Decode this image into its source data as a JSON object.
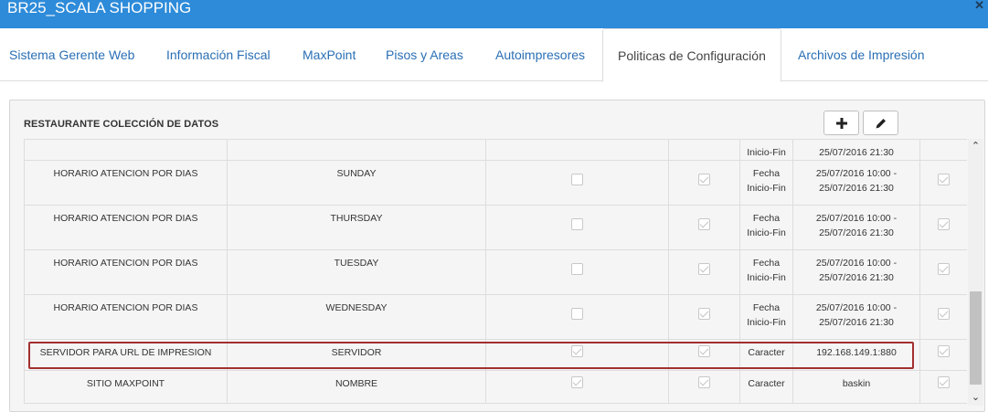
{
  "window": {
    "title": "BR25_SCALA SHOPPING",
    "close_glyph": "✕"
  },
  "tabs": [
    {
      "label": "Sistema Gerente Web"
    },
    {
      "label": "Información Fiscal"
    },
    {
      "label": "MaxPoint"
    },
    {
      "label": "Pisos y Areas"
    },
    {
      "label": "Autoimpresores"
    },
    {
      "label": "Politicas de Configuración"
    },
    {
      "label": "Archivos de Impresión"
    }
  ],
  "active_tab": "Politicas de Configuración",
  "panel": {
    "title": "RESTAURANTE COLECCIÓN DE DATOS",
    "add_button_icon": "plus-icon",
    "edit_button_icon": "pencil-icon"
  },
  "rows": [
    {
      "policy": "",
      "parameter": "",
      "checked1": null,
      "checked2": null,
      "type": "Inicio-Fin",
      "value": "25/07/2016 21:30",
      "active": null
    },
    {
      "policy": "HORARIO ATENCION POR DIAS",
      "parameter": "SUNDAY",
      "checked1": false,
      "checked2": true,
      "type_1": "Fecha",
      "type_2": "Inicio-Fin",
      "value_1": "25/07/2016 10:00 -",
      "value_2": "25/07/2016 21:30",
      "active": true
    },
    {
      "policy": "HORARIO ATENCION POR DIAS",
      "parameter": "THURSDAY",
      "checked1": false,
      "checked2": true,
      "type_1": "Fecha",
      "type_2": "Inicio-Fin",
      "value_1": "25/07/2016 10:00 -",
      "value_2": "25/07/2016 21:30",
      "active": true
    },
    {
      "policy": "HORARIO ATENCION POR DIAS",
      "parameter": "TUESDAY",
      "checked1": false,
      "checked2": true,
      "type_1": "Fecha",
      "type_2": "Inicio-Fin",
      "value_1": "25/07/2016 10:00 -",
      "value_2": "25/07/2016 21:30",
      "active": true
    },
    {
      "policy": "HORARIO ATENCION POR DIAS",
      "parameter": "WEDNESDAY",
      "checked1": false,
      "checked2": true,
      "type_1": "Fecha",
      "type_2": "Inicio-Fin",
      "value_1": "25/07/2016 10:00 -",
      "value_2": "25/07/2016 21:30",
      "active": true
    },
    {
      "policy": "SERVIDOR PARA URL DE IMPRESION",
      "parameter": "SERVIDOR",
      "checked1": true,
      "checked2": true,
      "type_1": "Caracter",
      "value_1": "192.168.149.1:880",
      "active": true
    },
    {
      "policy": "SITIO MAXPOINT",
      "parameter": "NOMBRE",
      "checked1": true,
      "checked2": true,
      "type_1": "Caracter",
      "value_1": "baskin",
      "active": true
    }
  ],
  "highlight_color": "#a32f2f",
  "accent_color": "#2d8bd9"
}
